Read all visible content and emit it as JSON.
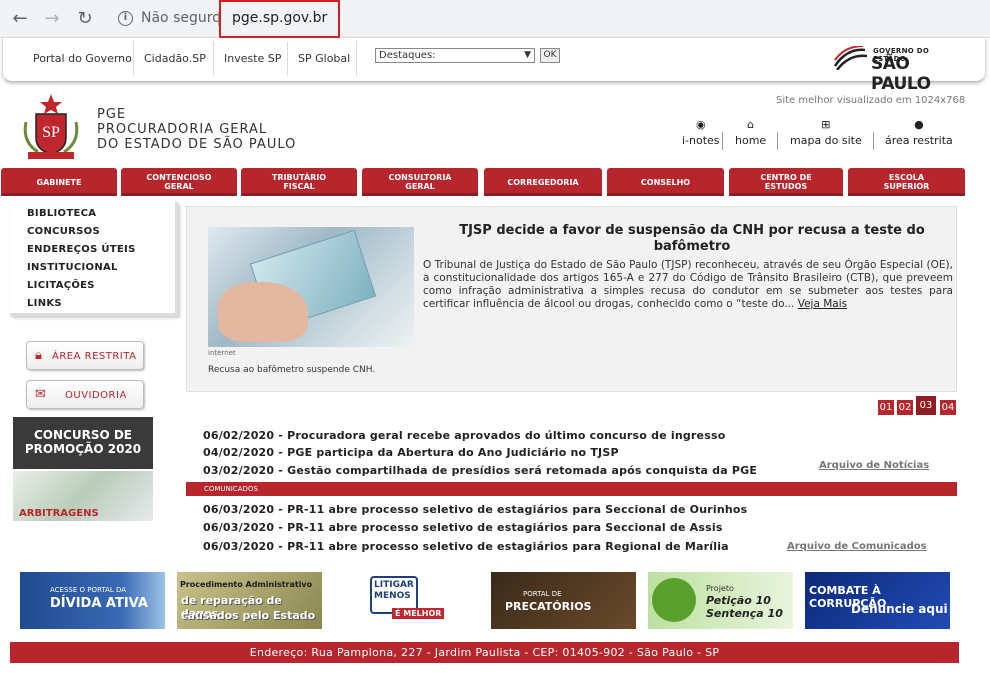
{
  "browser": {
    "security_label": "Não seguro",
    "url": "pge.sp.gov.br"
  },
  "gov_bar": {
    "links": [
      "Portal do Governo",
      "Cidadão.SP",
      "Investe SP",
      "SP Global"
    ],
    "select_value": "Destaques:",
    "ok_label": "OK",
    "logo_line1": "GOVERNO DO ESTADO",
    "logo_line2": "SÃO PAULO"
  },
  "header": {
    "resolution_note": "Site melhor visualizado em 1024x768",
    "title_line1": "PGE",
    "title_line2": "PROCURADORIA GERAL",
    "title_line3": "DO ESTADO DE SÃO PAULO",
    "crest_text": "SP",
    "tools": [
      "i-notes",
      "home",
      "mapa do site",
      "área restrita"
    ]
  },
  "main_nav": [
    "GABINETE",
    "CONTENCIOSO\nGERAL",
    "TRIBUTÁRIO\nFISCAL",
    "CONSULTORIA\nGERAL",
    "CORREGEDORIA",
    "CONSELHO",
    "CENTRO DE\nESTUDOS",
    "ESCOLA\nSUPERIOR"
  ],
  "side_menu": [
    "BIBLIOTECA",
    "CONCURSOS",
    "ENDEREÇOS ÚTEIS",
    "INSTITUCIONAL",
    "LICITAÇÕES",
    "LINKS"
  ],
  "side_buttons": {
    "restricted": "ÁREA RESTRITA",
    "ombudsman": "OUVIDORIA"
  },
  "promo": {
    "line1": "CONCURSO DE",
    "line2": "PROMOÇÃO 2020",
    "arbitragens": "ARBITRAGENS"
  },
  "featured": {
    "title": "TJSP decide a favor de suspensão da CNH por recusa a teste do bafômetro",
    "body": "O Tribunal de Justiça do Estado de São Paulo (TJSP) reconheceu, através de seu Órgão Especial (OE), a constitucionalidade dos artigos 165-A e 277 do Código de Trânsito Brasileiro (CTB), que preveem como infração administrativa a simples recusa do condutor em se submeter aos testes para certificar influência de álcool ou drogas, conhecido como o “teste do...",
    "more": "Veja Mais",
    "image_credit": "internet",
    "caption": "Recusa ao bafômetro suspende CNH."
  },
  "pager": [
    "01",
    "02",
    "03",
    "04"
  ],
  "news": [
    "06/02/2020 - Procuradora geral recebe aprovados do último concurso de ingresso",
    "04/02/2020 - PGE participa da Abertura do Ano Judiciário no TJSP",
    "03/02/2020 - Gestão compartilhada de presídios será retomada após conquista da PGE"
  ],
  "news_archive": "Arquivo de Notícias",
  "communiques_label": "COMUNICADOS",
  "communiques": [
    "06/03/2020 - PR-11 abre processo seletivo de estagiários para Seccional de Ourinhos",
    "06/03/2020 - PR-11 abre processo seletivo de estagiários para Seccional de Assis",
    "06/03/2020 - PR-11 abre processo seletivo de estagiários para Regional de Marília"
  ],
  "communiques_archive": "Arquivo de Comunicados",
  "banners": {
    "b1_small": "ACESSE O PORTAL DA",
    "b1_big": "DÍVIDA ATIVA",
    "b2_line1": "Procedimento Administrativo",
    "b2_line2": "de reparação de danos",
    "b2_line3": "causados pelo Estado",
    "b3_line1": "LITIGAR",
    "b3_line2": "MENOS",
    "b3_line3": "É MELHOR",
    "b4_small": "PORTAL DE",
    "b4_big": "PRECATÓRIOS",
    "b5_small": "Projeto",
    "b5_line1": "Petição 10",
    "b5_line2": "Sentença 10",
    "b6_line1": "COMBATE À CORRUPÇÃO",
    "b6_line2": "Denuncie aqui"
  },
  "footer": "Endereço: Rua Pamplona, 227 - Jardim Paulista - CEP: 01405-902 - São Paulo - SP"
}
